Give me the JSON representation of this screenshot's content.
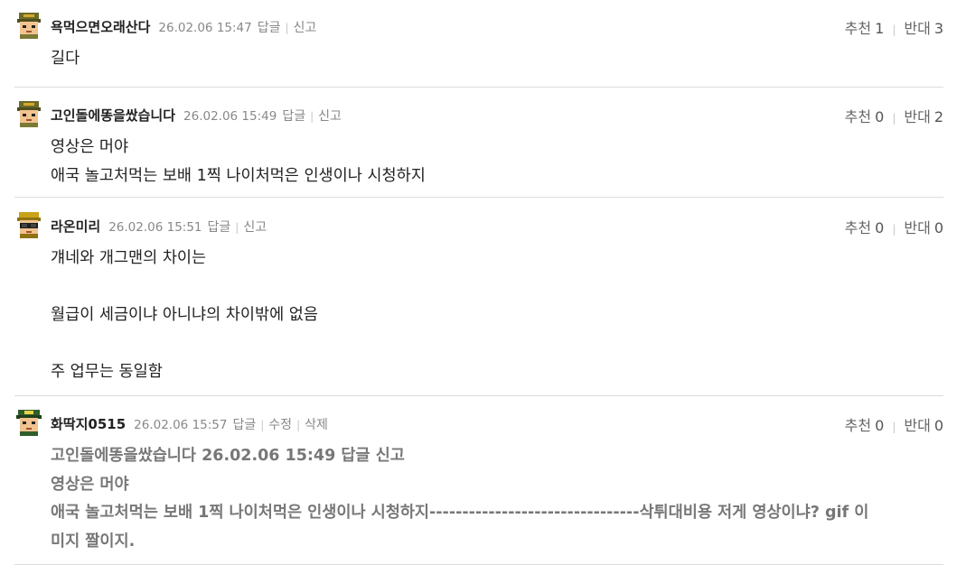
{
  "comments": [
    {
      "nickname": "욕먹으면오래산다",
      "date": "26.02.06 15:47",
      "actions": [
        "답글",
        "신고"
      ],
      "votes": {
        "up_label": "추천",
        "up": "1",
        "down_label": "반대",
        "down": "3"
      },
      "lines": [
        "길다"
      ],
      "avatar": "soldier-avatar-icon",
      "quoted": false
    },
    {
      "nickname": "고인돌에똥을쌌습니다",
      "date": "26.02.06 15:49",
      "actions": [
        "답글",
        "신고"
      ],
      "votes": {
        "up_label": "추천",
        "up": "0",
        "down_label": "반대",
        "down": "2"
      },
      "lines": [
        "영상은 머야",
        "애국 놀고처먹는 보배 1찍 나이처먹은 인생이나 시청하지"
      ],
      "avatar": "soldier-avatar-icon",
      "quoted": false
    },
    {
      "nickname": "라온미리",
      "date": "26.02.06 15:51",
      "actions": [
        "답글",
        "신고"
      ],
      "votes": {
        "up_label": "추천",
        "up": "0",
        "down_label": "반대",
        "down": "0"
      },
      "lines": [
        "걔네와 개그맨의 차이는",
        "",
        "월급이 세금이냐 아니냐의 차이밖에 없음",
        "",
        "주 업무는 동일함"
      ],
      "avatar": "goggles-avatar-icon",
      "quoted": false
    },
    {
      "nickname": "화딱지0515",
      "date": "26.02.06 15:57",
      "actions": [
        "답글",
        "수정",
        "삭제"
      ],
      "votes": {
        "up_label": "추천",
        "up": "0",
        "down_label": "반대",
        "down": "0"
      },
      "lines": [
        "고인돌에똥을쌌습니다 26.02.06 15:49 답글 신고",
        "영상은 머야",
        "애국 놀고처먹는 보배 1찍 나이처먹은 인생이나 시청하지--------------------------------삭튀대비용 저게 영상이냐? gif 이",
        "미지 짤이지."
      ],
      "avatar": "officer-avatar-icon",
      "quoted": true
    }
  ],
  "colors": {
    "border": "#dcdcdc",
    "meta": "#888888",
    "quote_text": "#777777"
  }
}
